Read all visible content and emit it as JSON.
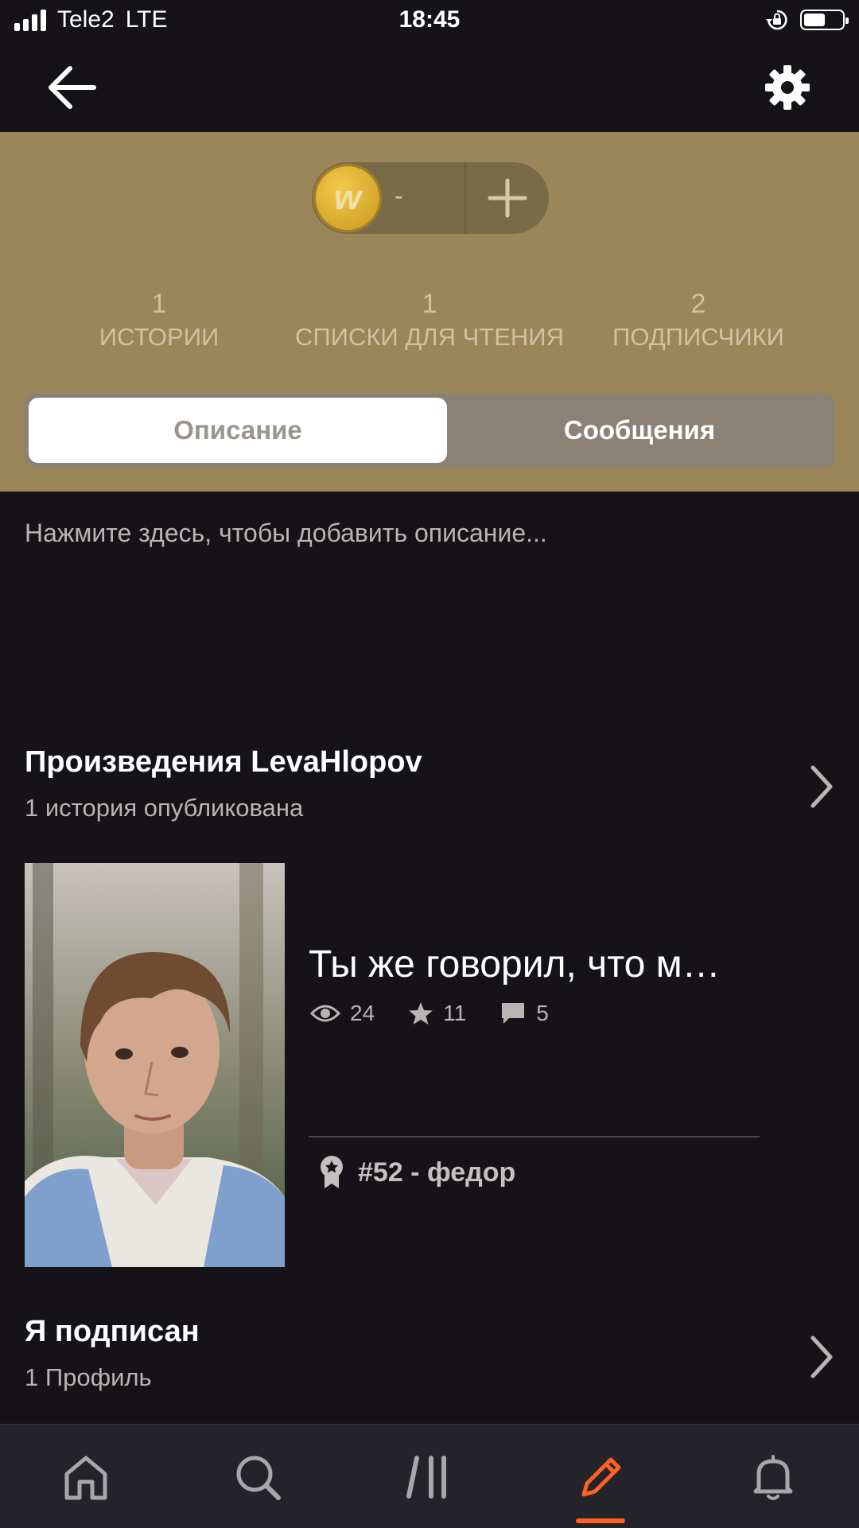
{
  "status_bar": {
    "carrier": "Tele2",
    "network": "LTE",
    "time": "18:45",
    "battery_fraction": 0.6
  },
  "nav": {
    "back_icon": "arrow-left-icon",
    "settings_icon": "gear-icon"
  },
  "coins": {
    "value": "-",
    "add_icon": "plus-icon",
    "coin_letter": "w"
  },
  "stats": [
    {
      "count": "1",
      "label": "ИСТОРИИ"
    },
    {
      "count": "1",
      "label": "СПИСКИ ДЛЯ ЧТЕНИЯ"
    },
    {
      "count": "2",
      "label": "ПОДПИСЧИКИ"
    }
  ],
  "tabs": {
    "active": "Описание",
    "inactive": "Сообщения"
  },
  "description_placeholder": "Нажмите здесь, чтобы добавить описание...",
  "works": {
    "title_prefix": "Произведения",
    "username": "LevaHlopov",
    "subtitle": "1 история опубликована"
  },
  "story": {
    "title": "Ты же говорил, что м…",
    "views": "24",
    "votes": "11",
    "comments": "5",
    "rank": "#52 - федор"
  },
  "following": {
    "title": "Я подписан",
    "subtitle": "1 Профиль"
  },
  "bottom_tabs": [
    "home-icon",
    "search-icon",
    "library-icon",
    "write-icon",
    "bell-icon"
  ],
  "colors": {
    "header_bg": "#9a8658",
    "accent": "#ff6122",
    "background": "#151318"
  }
}
